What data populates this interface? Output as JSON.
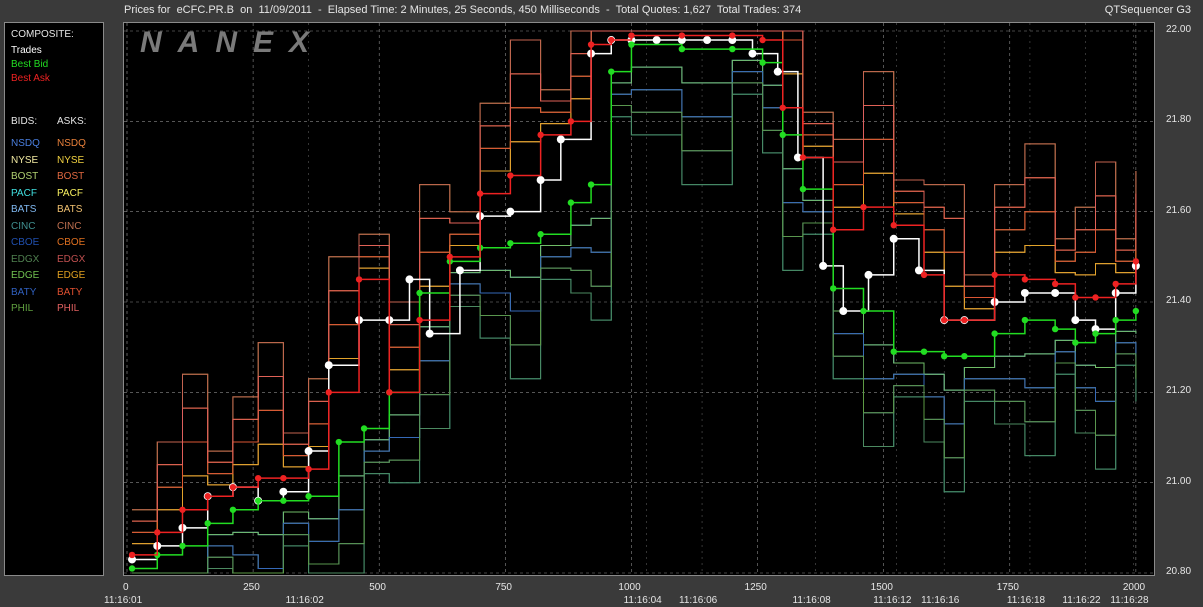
{
  "header": {
    "title": "Prices for  eCFC.PR.B  on  11/09/2011  -  Elapsed Time: 2 Minutes, 25 Seconds, 450 Milliseconds  -  Total Quotes: 1,627  Total Trades: 374",
    "app_name": "QTSequencer G3"
  },
  "watermark": "NANEX",
  "legend": {
    "composite_title": "COMPOSITE:",
    "composite": [
      {
        "label": "Trades",
        "color": "#ffffff"
      },
      {
        "label": "Best Bid",
        "color": "#22dd22"
      },
      {
        "label": "Best Ask",
        "color": "#ee2222"
      }
    ],
    "bids_title": "BIDS:",
    "asks_title": "ASKS:",
    "exchanges": [
      {
        "bid": "NSDQ",
        "ask": "NSDQ",
        "bid_color": "#4a7fe0",
        "ask_color": "#e8803a"
      },
      {
        "bid": "NYSE",
        "ask": "NYSE",
        "bid_color": "#f0e8a0",
        "ask_color": "#f0d040"
      },
      {
        "bid": "BOST",
        "ask": "BOST",
        "bid_color": "#b0d070",
        "ask_color": "#e06840"
      },
      {
        "bid": "PACF",
        "ask": "PACF",
        "bid_color": "#40e0e0",
        "ask_color": "#f8f060"
      },
      {
        "bid": "BATS",
        "ask": "BATS",
        "bid_color": "#80b8f0",
        "ask_color": "#f0c070"
      },
      {
        "bid": "CINC",
        "ask": "CINC",
        "bid_color": "#409090",
        "ask_color": "#c07050"
      },
      {
        "bid": "CBOE",
        "ask": "CBOE",
        "bid_color": "#2050b0",
        "ask_color": "#e07020"
      },
      {
        "bid": "EDGX",
        "ask": "EDGX",
        "bid_color": "#508050",
        "ask_color": "#c05050"
      },
      {
        "bid": "EDGE",
        "ask": "EDGE",
        "bid_color": "#70c050",
        "ask_color": "#e0a020"
      },
      {
        "bid": "BATY",
        "ask": "BATY",
        "bid_color": "#3060c0",
        "ask_color": "#e05030"
      },
      {
        "bid": "PHIL",
        "ask": "PHIL",
        "bid_color": "#60a040",
        "ask_color": "#e06060"
      }
    ]
  },
  "chart_data": {
    "type": "line",
    "title": "Prices for  eCFC.PR.B  on  11/09/2011",
    "xlim": [
      0,
      2030
    ],
    "ylim": [
      20.8,
      22.0
    ],
    "y_ticks": [
      "22.00",
      "21.80",
      "21.60",
      "21.40",
      "21.20",
      "21.00",
      "20.80"
    ],
    "x_ticks": [
      "0",
      "250",
      "500",
      "750",
      "1000",
      "1250",
      "1500",
      "1750",
      "2000"
    ],
    "time_labels": [
      {
        "x": 0,
        "label": "11:16:01"
      },
      {
        "x": 360,
        "label": "11:16:02"
      },
      {
        "x": 1030,
        "label": "11:16:04"
      },
      {
        "x": 1140,
        "label": "11:16:06"
      },
      {
        "x": 1365,
        "label": "11:16:08"
      },
      {
        "x": 1525,
        "label": "11:16:12"
      },
      {
        "x": 1620,
        "label": "11:16:16"
      },
      {
        "x": 1790,
        "label": "11:16:18"
      },
      {
        "x": 1900,
        "label": "11:16:22"
      },
      {
        "x": 1995,
        "label": "11:16:28"
      }
    ],
    "grid": true,
    "series": [
      {
        "name": "Trades",
        "color": "#ffffff",
        "x": [
          10,
          60,
          110,
          160,
          210,
          260,
          310,
          360,
          400,
          460,
          520,
          560,
          600,
          660,
          700,
          760,
          820,
          860,
          920,
          960,
          1000,
          1050,
          1100,
          1150,
          1200,
          1240,
          1290,
          1330,
          1380,
          1420,
          1470,
          1520,
          1570,
          1620,
          1660,
          1720,
          1780,
          1840,
          1880,
          1920,
          1960,
          2000
        ],
        "y": [
          20.83,
          20.86,
          20.9,
          20.97,
          20.99,
          20.96,
          20.98,
          21.07,
          21.26,
          21.36,
          21.36,
          21.45,
          21.33,
          21.47,
          21.59,
          21.6,
          21.67,
          21.76,
          21.95,
          21.98,
          21.98,
          21.98,
          21.98,
          21.98,
          21.98,
          21.95,
          21.91,
          21.72,
          21.48,
          21.38,
          21.46,
          21.54,
          21.47,
          21.36,
          21.36,
          21.4,
          21.42,
          21.42,
          21.36,
          21.34,
          21.42,
          21.48
        ]
      },
      {
        "name": "Best Bid",
        "color": "#22dd22",
        "x": [
          10,
          60,
          110,
          160,
          210,
          260,
          310,
          360,
          420,
          470,
          520,
          580,
          640,
          700,
          760,
          820,
          880,
          920,
          960,
          1000,
          1100,
          1200,
          1260,
          1300,
          1340,
          1400,
          1460,
          1520,
          1580,
          1620,
          1660,
          1720,
          1780,
          1840,
          1880,
          1920,
          1960,
          2000
        ],
        "y": [
          20.81,
          20.84,
          20.86,
          20.91,
          20.94,
          20.96,
          20.96,
          20.97,
          21.09,
          21.12,
          21.2,
          21.42,
          21.49,
          21.52,
          21.53,
          21.55,
          21.62,
          21.66,
          21.91,
          21.97,
          21.96,
          21.96,
          21.93,
          21.77,
          21.65,
          21.43,
          21.38,
          21.29,
          21.29,
          21.28,
          21.28,
          21.33,
          21.36,
          21.34,
          21.31,
          21.33,
          21.36,
          21.38
        ]
      },
      {
        "name": "Best Ask",
        "color": "#ee2222",
        "x": [
          10,
          60,
          110,
          160,
          210,
          260,
          310,
          360,
          400,
          460,
          520,
          580,
          640,
          700,
          760,
          820,
          880,
          920,
          960,
          1000,
          1100,
          1200,
          1260,
          1300,
          1340,
          1400,
          1460,
          1520,
          1580,
          1620,
          1660,
          1720,
          1780,
          1840,
          1880,
          1920,
          1960,
          2000
        ],
        "y": [
          20.84,
          20.89,
          20.94,
          20.97,
          20.99,
          21.01,
          21.01,
          21.03,
          21.2,
          21.45,
          21.2,
          21.36,
          21.5,
          21.64,
          21.68,
          21.77,
          21.8,
          21.97,
          21.98,
          21.99,
          21.99,
          21.99,
          21.98,
          21.83,
          21.72,
          21.56,
          21.61,
          21.57,
          21.46,
          21.36,
          21.36,
          21.46,
          21.45,
          21.44,
          21.41,
          21.41,
          21.44,
          21.49
        ]
      }
    ]
  }
}
